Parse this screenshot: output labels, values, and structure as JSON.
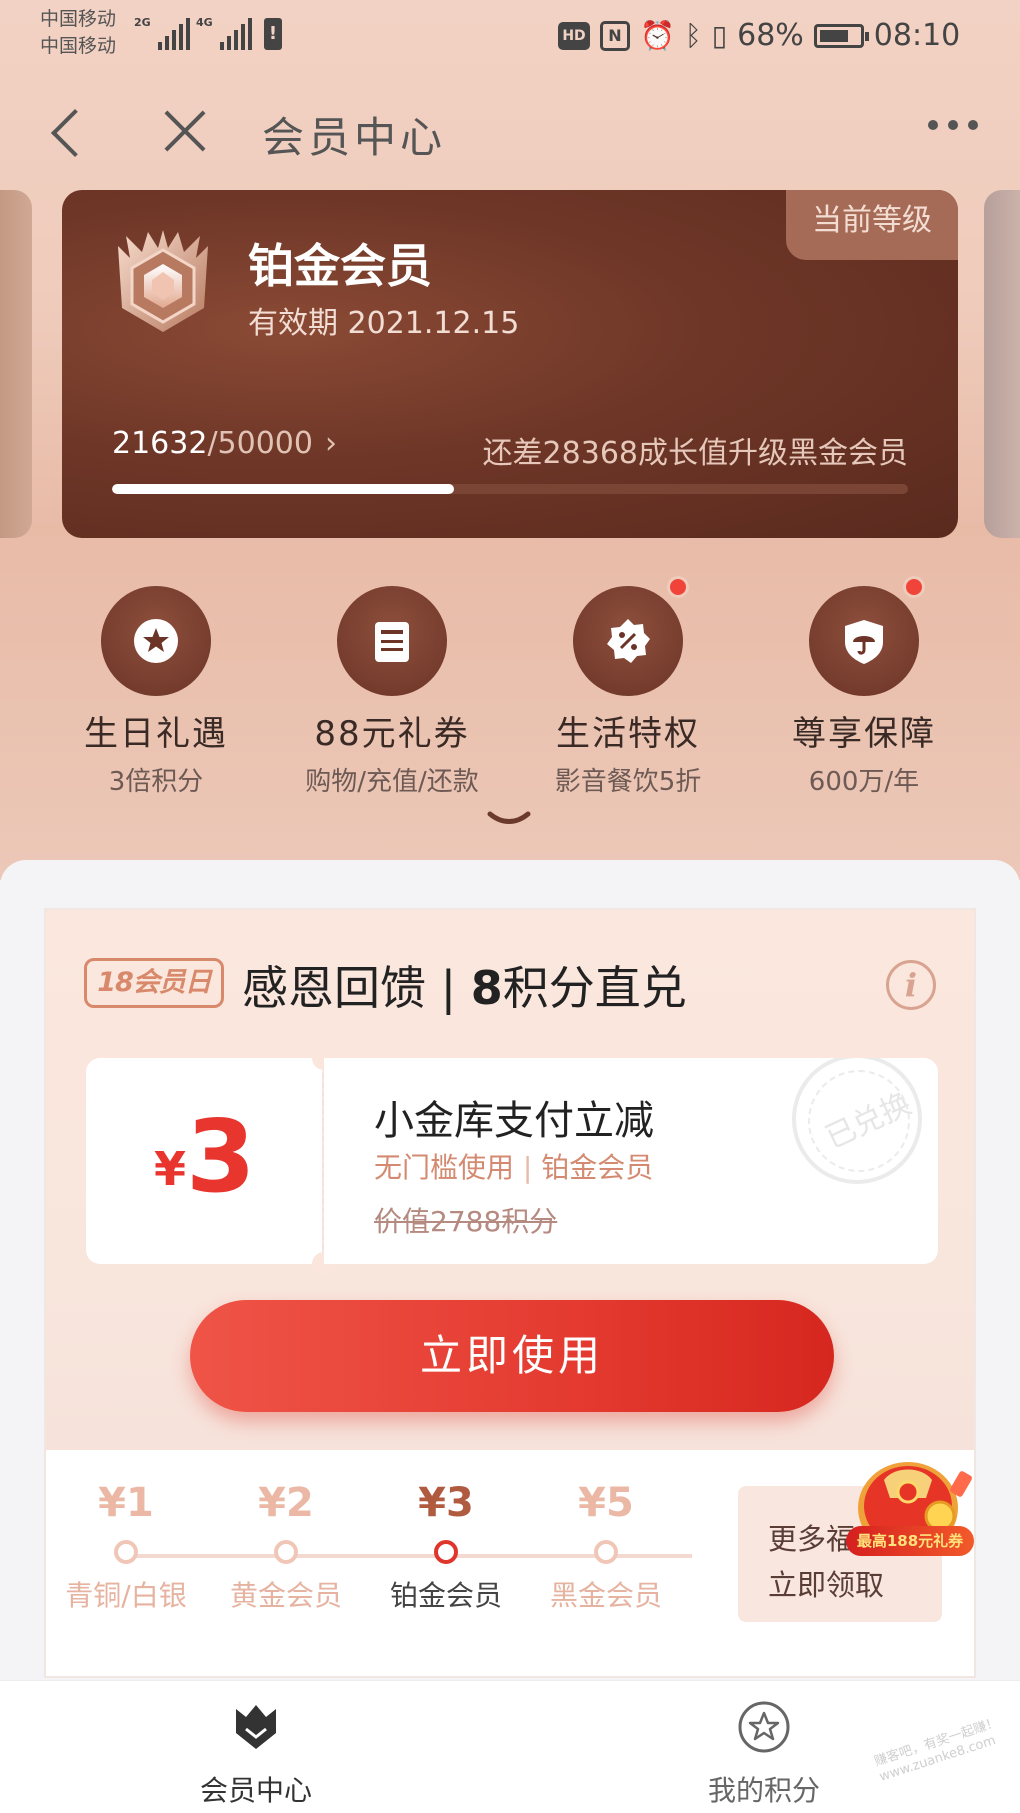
{
  "status_bar": {
    "carrier_1": "中国移动",
    "carrier_2": "中国移动",
    "net_1": "2G",
    "net_2": "4G",
    "battery_percent": "68%",
    "time": "08:10"
  },
  "nav": {
    "title": "会员中心",
    "back_icon": "back-chevron-icon",
    "close_icon": "close-icon",
    "more_icon": "more-dots-icon"
  },
  "member_card": {
    "level_tag": "当前等级",
    "title": "铂金会员",
    "valid_label": "有效期",
    "valid_date": "2021.12.15",
    "current_points": "21632",
    "total_points": "/50000",
    "progress_fraction": 0.43,
    "upgrade_text": "还差28368成长值升级黑金会员"
  },
  "benefits": [
    {
      "title": "生日礼遇",
      "sub": "3倍积分",
      "icon": "star-icon",
      "has_dot": false
    },
    {
      "title": "88元礼券",
      "sub": "购物/充值/还款",
      "icon": "coupon-icon",
      "has_dot": false
    },
    {
      "title": "生活特权",
      "sub": "影音餐饮5折",
      "icon": "discount-icon",
      "has_dot": true
    },
    {
      "title": "尊享保障",
      "sub": "600万/年",
      "icon": "shield-umbrella-icon",
      "has_dot": true
    }
  ],
  "promo": {
    "logo": "18会员日",
    "title_prefix": "感恩回馈 | ",
    "title_bold": "8",
    "title_suffix": "积分直兑",
    "coupon": {
      "currency": "¥",
      "amount": "3",
      "title": "小金库支付立减",
      "desc_1": "无门槛使用",
      "desc_sep": " | ",
      "desc_2": "铂金会员",
      "value": "价值2788积分",
      "stamp": "已兑换"
    },
    "use_button": "立即使用",
    "tiers": [
      {
        "price": "¥1",
        "name": "青铜/白银",
        "active": false
      },
      {
        "price": "¥2",
        "name": "黄金会员",
        "active": false
      },
      {
        "price": "¥3",
        "name": "铂金会员",
        "active": true
      },
      {
        "price": "¥5",
        "name": "黑金会员",
        "active": false
      }
    ],
    "more_line1": "更多福",
    "more_line2": "立即领取",
    "gift_tag": "最高188元礼券"
  },
  "tabbar": {
    "tab1": "会员中心",
    "tab2": "我的积分"
  },
  "watermark": "赚客吧，有奖一起赚！ www.zuanke8.com",
  "colors": {
    "accent_red": "#e43a30",
    "card_brown": "#6e3627",
    "bg_pink": "#efcbbb"
  }
}
